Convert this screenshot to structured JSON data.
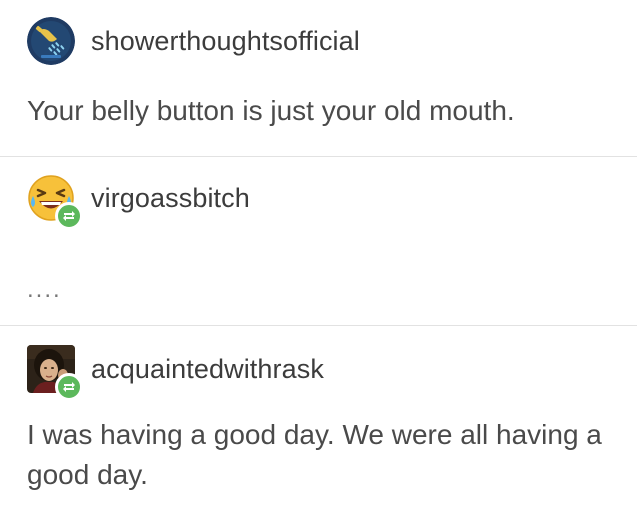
{
  "posts": [
    {
      "username": "showerthoughtsofficial",
      "text": "Your belly button is just your old mouth.",
      "avatar": "shower-head-avatar-icon",
      "reblog": false
    },
    {
      "username": "virgoassbitch",
      "text": "....",
      "avatar": "laughing-emoji-avatar-icon",
      "reblog": true
    },
    {
      "username": "acquaintedwithrask",
      "text": "I was having a good day. We were all having a good day.",
      "avatar": "portrait-avatar",
      "reblog": true
    }
  ],
  "colors": {
    "reblog_badge": "#5cb85c",
    "divider": "#e2e2e2",
    "text": "#4a4a4a"
  }
}
